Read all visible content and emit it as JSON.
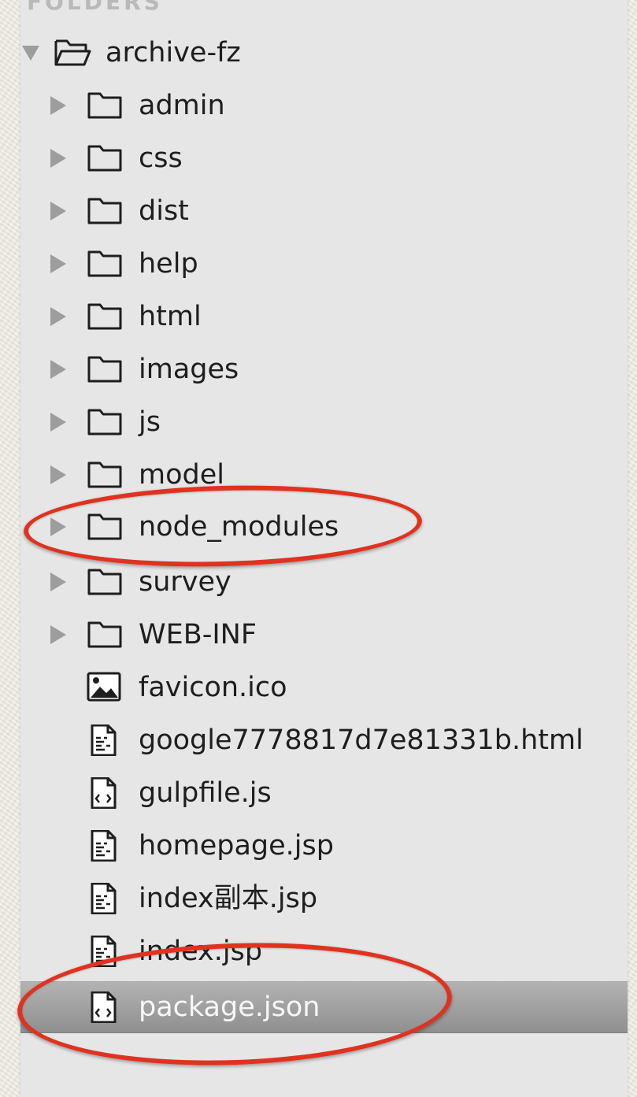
{
  "sidebar": {
    "header": "FOLDERS",
    "root": {
      "label": "archive-fz",
      "expanded": true
    },
    "items": [
      {
        "label": "admin",
        "type": "folder"
      },
      {
        "label": "css",
        "type": "folder"
      },
      {
        "label": "dist",
        "type": "folder"
      },
      {
        "label": "help",
        "type": "folder"
      },
      {
        "label": "html",
        "type": "folder"
      },
      {
        "label": "images",
        "type": "folder"
      },
      {
        "label": "js",
        "type": "folder"
      },
      {
        "label": "model",
        "type": "folder"
      },
      {
        "label": "node_modules",
        "type": "folder",
        "annotated": true
      },
      {
        "label": "survey",
        "type": "folder"
      },
      {
        "label": "WEB-INF",
        "type": "folder"
      },
      {
        "label": "favicon.ico",
        "type": "image-file"
      },
      {
        "label": "google7778817d7e81331b.html",
        "type": "text-file"
      },
      {
        "label": "gulpfile.js",
        "type": "code-file"
      },
      {
        "label": "homepage.jsp",
        "type": "text-file"
      },
      {
        "label": "index副本.jsp",
        "type": "text-file"
      },
      {
        "label": "index.jsp",
        "type": "text-file"
      },
      {
        "label": "package.json",
        "type": "code-file",
        "selected": true,
        "annotated": true
      }
    ]
  },
  "colors": {
    "annotation": "#e0321f",
    "selection": "#9a9a9a",
    "sidebar_bg": "#e6e6e6"
  }
}
